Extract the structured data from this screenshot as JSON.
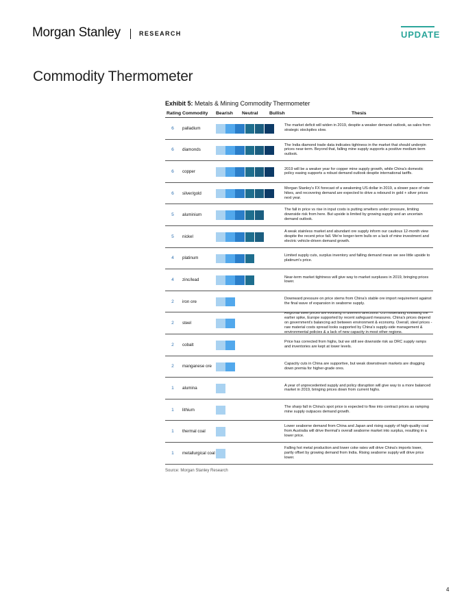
{
  "header": {
    "brand": "Morgan Stanley",
    "section": "RESEARCH",
    "badge": "UPDATE"
  },
  "page_title": "Commodity Thermometer",
  "exhibit": {
    "label": "Exhibit 5:",
    "title": "Metals & Mining Commodity Thermometer"
  },
  "columns": {
    "rating": "Rating",
    "commodity": "Commodity",
    "bearish": "Bearish",
    "neutral": "Neutral",
    "bullish": "Bullish",
    "thesis": "Thesis"
  },
  "colors": {
    "scale": [
      "#a9d2f1",
      "#52a8ec",
      "#2a7ec9",
      "#1e6e8e",
      "#1b5e80",
      "#0c3a66"
    ],
    "rating_text": "#2c6fb0",
    "update_accent": "#2aa59a"
  },
  "rows": [
    {
      "rating": "6",
      "commodity": "palladium",
      "thesis": "The market deficit will widen in 2019, despite a weaker demand outlook, as sales from strategic stockpiles slow."
    },
    {
      "rating": "6",
      "commodity": "diamonds",
      "thesis": "The India diamond trade data indicates tightness in the market that should underpin prices near-term. Beyond that, falling mine supply supports a positive medium-term outlook."
    },
    {
      "rating": "6",
      "commodity": "copper",
      "thesis": "2019 will be a weaker year for copper mine supply growth, while China's domestic policy easing supports a robust demand outlook despite international tariffs."
    },
    {
      "rating": "6",
      "commodity": "silver/gold",
      "thesis": "Morgan Stanley's FX forecast of a weakening US dollar in 2019, a slower pace of rate hikes, and recovering demand are expected to drive a rebound in gold + silver prices next year."
    },
    {
      "rating": "5",
      "commodity": "aluminium",
      "thesis": "The fall in price vs rise in input costs is putting smelters under pressure, limiting downside risk from here. But upside is limited by growing supply and an uncertain demand outlook."
    },
    {
      "rating": "5",
      "commodity": "nickel",
      "thesis": "A weak stainless market and abundant ore supply inform our cautious 12-month view despite the recent price fall. We're longer-term bulls on a lack of mine investment and electric vehicle-driven demand growth."
    },
    {
      "rating": "4",
      "commodity": "platinum",
      "thesis": "Limited supply cuts, surplus inventory and falling demand mean we see little upside to platinum's price."
    },
    {
      "rating": "4",
      "commodity": "zinc/lead",
      "thesis": "Near-term market tightness will give way to market surpluses in 2019, bringing prices lower."
    },
    {
      "rating": "2",
      "commodity": "iron ore",
      "thesis": "Downward pressure on price stems from China's stable ore import requirement against the final wave of expansion in seaborne supply."
    },
    {
      "rating": "2",
      "commodity": "steel",
      "thesis": "Regional steel prices are evolving in different directions: US moderating following the earlier spike, Europe supported by recent safeguard measures. China's prices depend on government's balancing act between environment & economy. Overall, steel prices - raw material costs spread looks supported by China's supply-side management & environmental policies & a lack of new capacity in most other regions."
    },
    {
      "rating": "2",
      "commodity": "cobalt",
      "thesis": "Price has corrected from highs, but we still see downside risk as DRC supply ramps and inventories are kept at lower levels."
    },
    {
      "rating": "2",
      "commodity": "manganese ore",
      "thesis": "Capacity cuts in China are supportive, but weak downstream markets are dragging down premia for higher-grade ores."
    },
    {
      "rating": "1",
      "commodity": "alumina",
      "thesis": "A year of unprecedented supply and policy disruption will give way to a more balanced market in 2019, bringing prices down from current highs."
    },
    {
      "rating": "1",
      "commodity": "lithium",
      "thesis": "The sharp fall in China's spot price is expected to flow into contract prices as ramping mine supply outpaces demand growth."
    },
    {
      "rating": "1",
      "commodity": "thermal coal",
      "thesis": "Lower seaborne demand from China and Japan and rising supply of high-quality coal from Australia will drive thermal's overall seaborne market into surplus, resulting in a lower price."
    },
    {
      "rating": "1",
      "commodity": "metallurgical coal",
      "thesis": "Falling hot metal production and lower coke rates will drive China's imports lower, partly offset by growing demand from India. Rising seaborne supply will drive price lower."
    }
  ],
  "source": "Source: Morgan Stanley Research",
  "page_number": "4"
}
